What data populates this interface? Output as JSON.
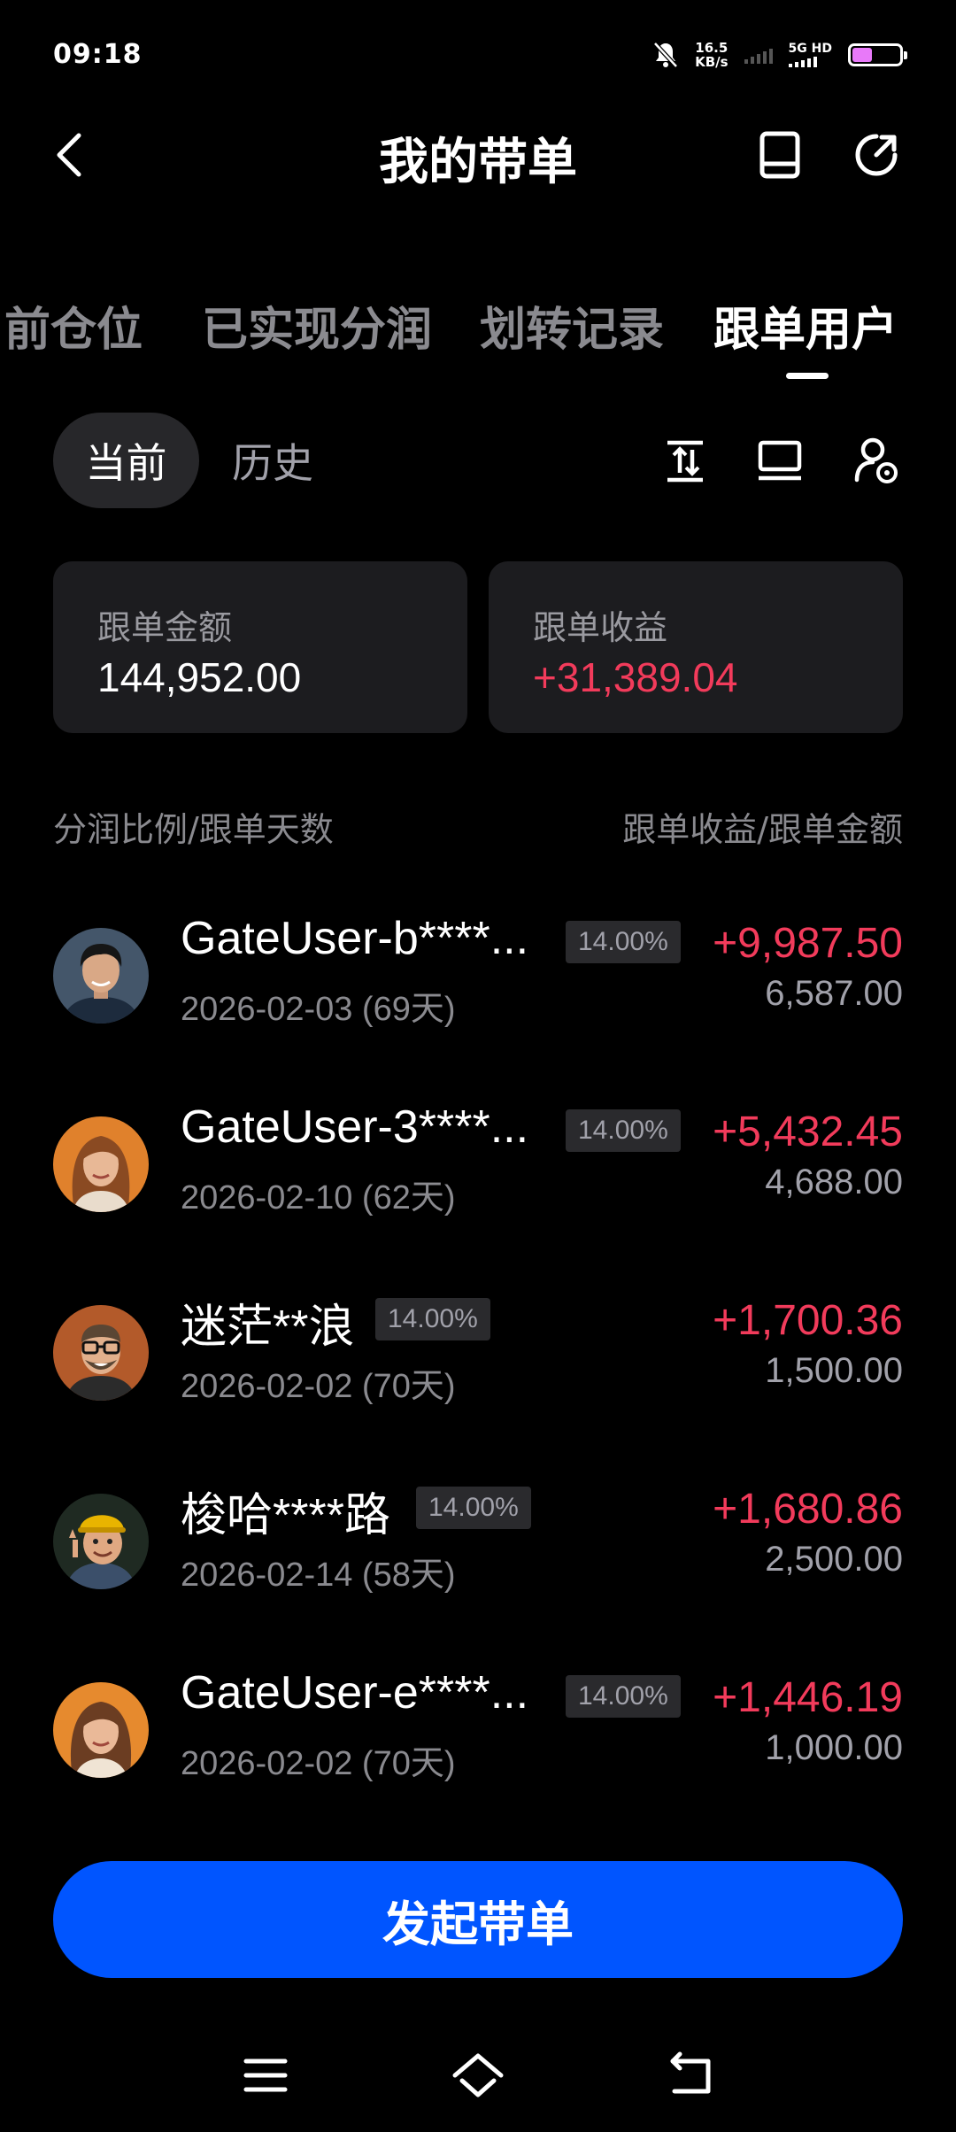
{
  "status_bar": {
    "time": "09:18",
    "net_speed": "16.5",
    "net_unit": "KB/s",
    "network": "5G HD",
    "battery": "44"
  },
  "header": {
    "title": "我的带单",
    "back_icon": "chevron-left-icon",
    "book_icon": "book-icon",
    "share_icon": "share-icon"
  },
  "tabs": [
    {
      "label": "当前仓位"
    },
    {
      "label": "已实现分润"
    },
    {
      "label": "划转记录"
    },
    {
      "label": "跟单用户",
      "active": true
    }
  ],
  "segment": {
    "current": "当前",
    "history": "历史"
  },
  "tools": [
    "sort-icon",
    "screen-icon",
    "user-settings-icon"
  ],
  "summary": {
    "amount_label": "跟单金额",
    "amount_value": "144,952.00",
    "profit_label": "跟单收益",
    "profit_value": "+31,389.04"
  },
  "columns": {
    "left": "分润比例/跟单天数",
    "right": "跟单收益/跟单金额"
  },
  "users": [
    {
      "name": "GateUser-b****...",
      "ratio": "14.00%",
      "date": "2026-02-03 (69天)",
      "profit": "+9,987.50",
      "amount": "6,587.00"
    },
    {
      "name": "GateUser-3****...",
      "ratio": "14.00%",
      "date": "2026-02-10 (62天)",
      "profit": "+5,432.45",
      "amount": "4,688.00"
    },
    {
      "name": "迷茫**浪",
      "ratio": "14.00%",
      "date": "2026-02-02 (70天)",
      "profit": "+1,700.36",
      "amount": "1,500.00"
    },
    {
      "name": "梭哈****路",
      "ratio": "14.00%",
      "date": "2026-02-14 (58天)",
      "profit": "+1,680.86",
      "amount": "2,500.00"
    },
    {
      "name": "GateUser-e****...",
      "ratio": "14.00%",
      "date": "2026-02-02 (70天)",
      "profit": "+1,446.19",
      "amount": "1,000.00"
    }
  ],
  "cta": {
    "label": "发起带单"
  },
  "colors": {
    "accent": "#0055ff",
    "profit": "#f23b5b",
    "card": "#1c1c1f"
  }
}
